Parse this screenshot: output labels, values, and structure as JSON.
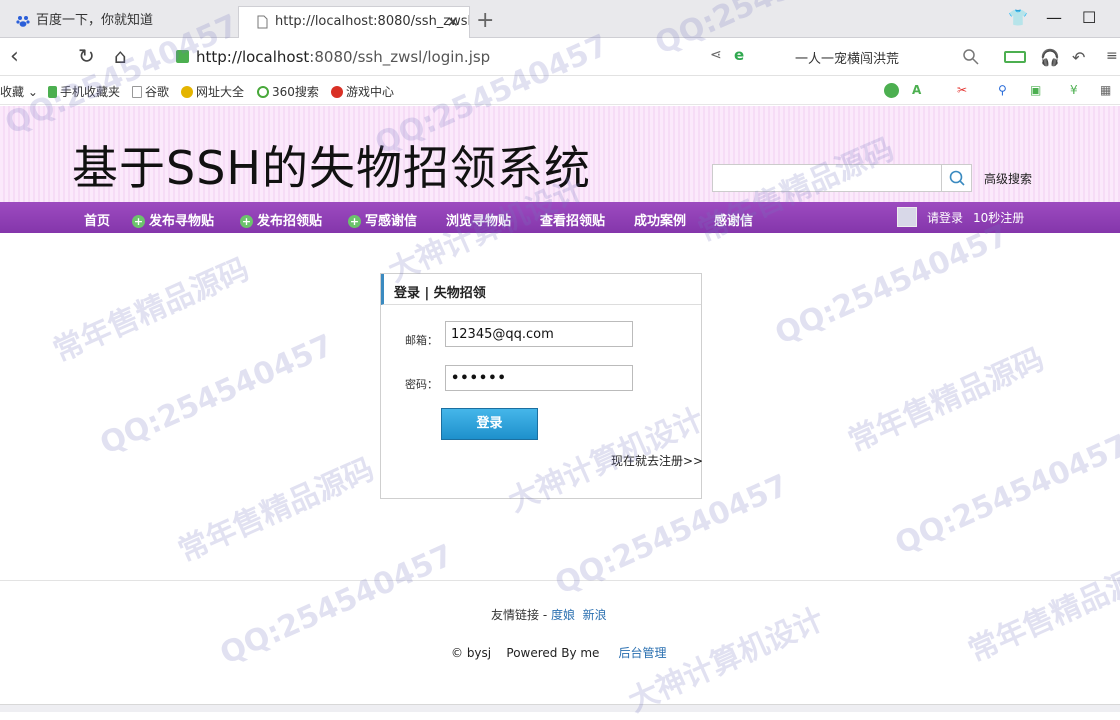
{
  "browser": {
    "tabs": [
      {
        "title": "百度一下，你就知道",
        "active": false
      },
      {
        "title": "http://localhost:8080/ssh_zwsl",
        "active": true
      }
    ],
    "url_host": "http://localhost",
    "url_rest": ":8080/ssh_zwsl/login.jsp",
    "search_hint": "一人一宠横闯洪荒",
    "bookmarks": [
      "收藏",
      "手机收藏夹",
      "谷歌",
      "网址大全",
      "360搜索",
      "游戏中心"
    ]
  },
  "site": {
    "title": "基于SSH的失物招领系统",
    "search_placeholder": "",
    "advanced_search": "高级搜索",
    "nav": [
      {
        "label": "首页",
        "plus": false
      },
      {
        "label": "发布寻物贴",
        "plus": true
      },
      {
        "label": "发布招领贴",
        "plus": true
      },
      {
        "label": "写感谢信",
        "plus": true
      },
      {
        "label": "浏览寻物贴",
        "plus": false
      },
      {
        "label": "查看招领贴",
        "plus": false
      },
      {
        "label": "成功案例",
        "plus": false
      },
      {
        "label": "感谢信",
        "plus": false
      }
    ],
    "login_link": "请登录",
    "register_link": "10秒注册"
  },
  "login": {
    "title": "登录 | 失物招领",
    "email_label": "邮箱：",
    "email_value": "12345@qq.com",
    "password_label": "密码：",
    "password_value": "••••••",
    "submit": "登录",
    "register_hint": "现在就去注册>>"
  },
  "footer": {
    "links_label": "友情链接 -",
    "link1": "度娘",
    "link2": "新浪",
    "copyright": "© bysj",
    "powered": "Powered By me",
    "admin": "后台管理"
  },
  "watermarks": [
    "QQ:254540457",
    "常年售精品源码",
    "大神计算机设计",
    "收藏"
  ]
}
